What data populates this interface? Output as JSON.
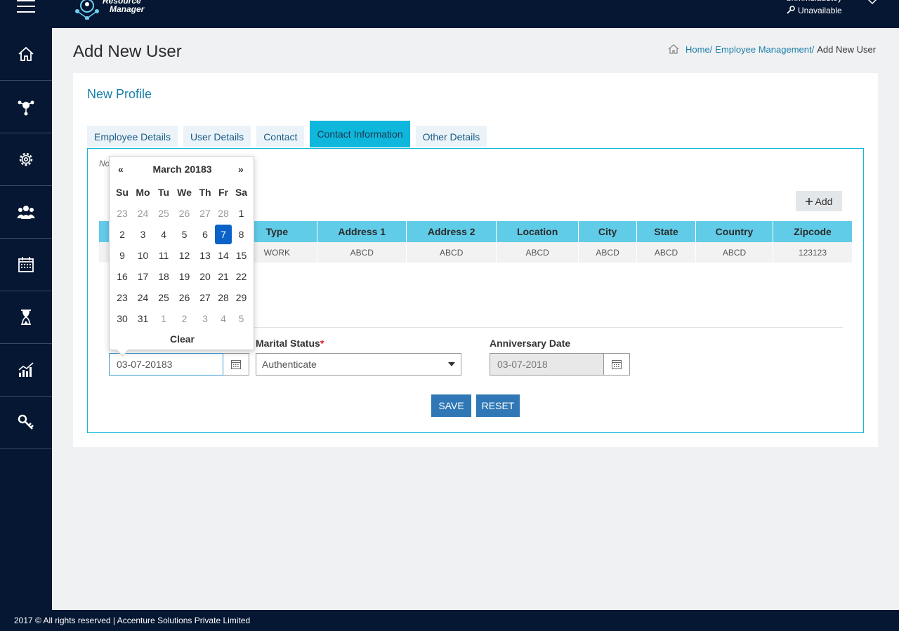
{
  "header": {
    "logo_line1": "Resource",
    "logo_line2": "Manager",
    "user_name": "bhmmulaudtey",
    "status": "Unavailable"
  },
  "page": {
    "title": "Add New User",
    "breadcrumb": {
      "home": "Home/",
      "section": "Employee Management/",
      "current": "Add New User"
    }
  },
  "card": {
    "title": "New Profile",
    "tabs": [
      "Employee Details",
      "User Details",
      "Contact",
      "Contact Information",
      "Other Details"
    ],
    "active_tab": "Contact Information",
    "note": "No",
    "add_label": "Add"
  },
  "table": {
    "headers": [
      "Type",
      "Address 1",
      "Address 2",
      "Location",
      "City",
      "State",
      "Country",
      "Zipcode"
    ],
    "rows": [
      [
        "WORK",
        "ABCD",
        "ABCD",
        "ABCD",
        "ABCD",
        "ABCD",
        "ABCD",
        "123123"
      ]
    ]
  },
  "form": {
    "dob_value": "03-07-20183",
    "marital_label": "Marital Status",
    "marital_required": "*",
    "marital_value": "Authenticate",
    "anniversary_label": "Anniversary Date",
    "anniversary_value": "03-07-2018",
    "save_label": "SAVE",
    "reset_label": "RESET"
  },
  "datepicker": {
    "prev": "«",
    "next": "»",
    "title": "March 20183",
    "days_of_week": [
      "Su",
      "Mo",
      "Tu",
      "We",
      "Th",
      "Fr",
      "Sa"
    ],
    "weeks": [
      [
        "23",
        "24",
        "25",
        "26",
        "27",
        "28",
        "1"
      ],
      [
        "2",
        "3",
        "4",
        "5",
        "6",
        "7",
        "8"
      ],
      [
        "9",
        "10",
        "11",
        "12",
        "13",
        "14",
        "15"
      ],
      [
        "16",
        "17",
        "18",
        "19",
        "20",
        "21",
        "22"
      ],
      [
        "23",
        "24",
        "25",
        "26",
        "27",
        "28",
        "29"
      ],
      [
        "30",
        "31",
        "1",
        "2",
        "3",
        "4",
        "5"
      ]
    ],
    "selected": "7",
    "clear_label": "Clear"
  },
  "footer": {
    "text": "2017 © All rights reserved | Accenture Solutions Private Limited"
  }
}
